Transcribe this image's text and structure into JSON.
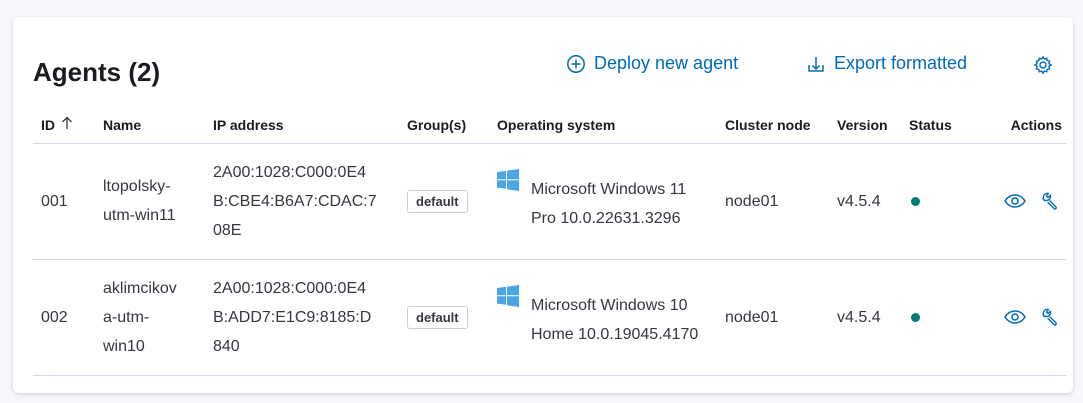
{
  "header": {
    "title": "Agents (2)",
    "deploy_label": "Deploy new agent",
    "export_label": "Export formatted"
  },
  "columns": {
    "id": "ID",
    "name": "Name",
    "ip": "IP address",
    "groups": "Group(s)",
    "os": "Operating system",
    "cluster_node": "Cluster node",
    "version": "Version",
    "status": "Status",
    "actions": "Actions"
  },
  "rows": [
    {
      "id": "001",
      "name": [
        "ltopolsky-",
        "utm-win11"
      ],
      "ip": [
        "2A00:1028:C000:0E4",
        "B:CBE4:B6A7:CDAC:7",
        "08E"
      ],
      "group": "default",
      "os": [
        "Microsoft Windows 11",
        "Pro 10.0.22631.3296"
      ],
      "cluster_node": "node01",
      "version": "v4.5.4",
      "status": "active"
    },
    {
      "id": "002",
      "name": [
        "aklimcikov",
        "a-utm-",
        "win10"
      ],
      "ip": [
        "2A00:1028:C000:0E4",
        "B:ADD7:E1C9:8185:D",
        "840"
      ],
      "group": "default",
      "os": [
        "Microsoft Windows 10",
        "Home 10.0.19045.4170"
      ],
      "cluster_node": "node01",
      "version": "v4.5.4",
      "status": "active"
    }
  ],
  "colors": {
    "link": "#006bb8",
    "status_active": "#017d73",
    "windows_logo": "#4aa6e6"
  },
  "icons": {
    "deploy": "plus-circle-icon",
    "export": "export-icon",
    "settings": "gear-icon",
    "sort": "arrow-up-icon",
    "os": "windows-logo-icon",
    "view": "eye-icon",
    "configure": "wrench-icon"
  }
}
